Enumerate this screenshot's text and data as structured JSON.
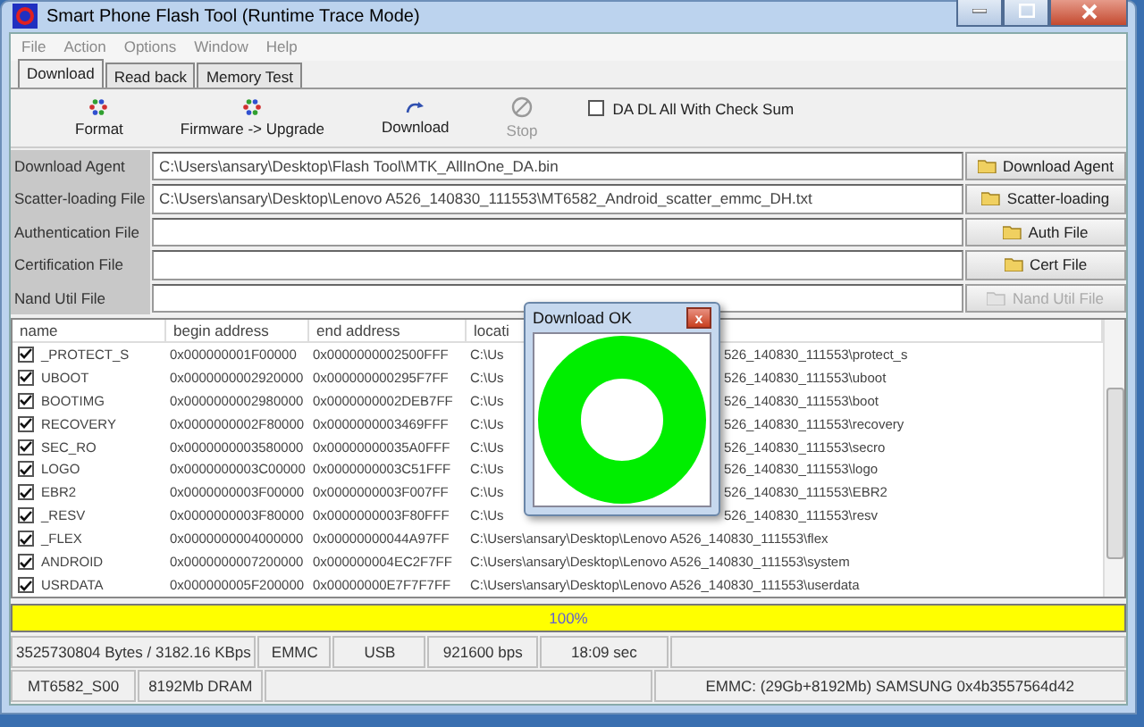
{
  "window": {
    "title": "Smart Phone Flash Tool (Runtime Trace Mode)"
  },
  "menu": [
    {
      "label": "File",
      "disabled": true
    },
    {
      "label": "Action",
      "disabled": true
    },
    {
      "label": "Options",
      "disabled": true
    },
    {
      "label": "Window",
      "disabled": true
    },
    {
      "label": "Help",
      "disabled": true
    }
  ],
  "tabs": [
    {
      "label": "Download",
      "selected": true
    },
    {
      "label": "Read back",
      "selected": false
    },
    {
      "label": "Memory Test",
      "selected": false
    }
  ],
  "toolbar": [
    {
      "kind": "format",
      "label": "Format",
      "disabled": false
    },
    {
      "kind": "firmware",
      "label": "Firmware -> Upgrade",
      "disabled": false
    },
    {
      "kind": "download",
      "label": "Download",
      "disabled": false
    },
    {
      "kind": "stop",
      "label": "Stop",
      "disabled": true
    }
  ],
  "checksum": {
    "label": "DA DL All With Check Sum",
    "checked": false
  },
  "file_rows": [
    {
      "label": "Download Agent",
      "value": "C:\\Users\\ansary\\Desktop\\Flash Tool\\MTK_AllInOne_DA.bin",
      "button": "Download Agent",
      "disabled": false
    },
    {
      "label": "Scatter-loading File",
      "value": "C:\\Users\\ansary\\Desktop\\Lenovo A526_140830_111553\\MT6582_Android_scatter_emmc_DH.txt",
      "button": "Scatter-loading",
      "disabled": false
    },
    {
      "label": "Authentication File",
      "value": "",
      "button": "Auth File",
      "disabled": false
    },
    {
      "label": "Certification File",
      "value": "",
      "button": "Cert File",
      "disabled": false
    },
    {
      "label": "Nand Util File",
      "value": "",
      "button": "Nand Util File",
      "disabled": true
    }
  ],
  "table": {
    "columns": [
      "name",
      "begin address",
      "end address",
      "locati"
    ],
    "rows": [
      {
        "checked": true,
        "name": "_PROTECT_S",
        "begin": "0x000000001F00000",
        "end": "0x0000000002500FFF",
        "location": "C:\\Us",
        "location_tail": "526_140830_111553\\protect_s"
      },
      {
        "checked": true,
        "name": "UBOOT",
        "begin": "0x0000000002920000",
        "end": "0x000000000295F7FF",
        "location": "C:\\Us",
        "location_tail": "526_140830_111553\\uboot"
      },
      {
        "checked": true,
        "name": "BOOTIMG",
        "begin": "0x0000000002980000",
        "end": "0x0000000002DEB7FF",
        "location": "C:\\Us",
        "location_tail": "526_140830_111553\\boot"
      },
      {
        "checked": true,
        "name": "RECOVERY",
        "begin": "0x0000000002F80000",
        "end": "0x0000000003469FFF",
        "location": "C:\\Us",
        "location_tail": "526_140830_111553\\recovery"
      },
      {
        "checked": true,
        "name": "SEC_RO",
        "begin": "0x0000000003580000",
        "end": "0x00000000035A0FFF",
        "location": "C:\\Us",
        "location_tail": "526_140830_111553\\secro"
      },
      {
        "checked": true,
        "name": "LOGO",
        "begin": "0x0000000003C00000",
        "end": "0x0000000003C51FFF",
        "location": "C:\\Us",
        "location_tail": "526_140830_111553\\logo"
      },
      {
        "checked": true,
        "name": "EBR2",
        "begin": "0x0000000003F00000",
        "end": "0x0000000003F007FF",
        "location": "C:\\Us",
        "location_tail": "526_140830_111553\\EBR2"
      },
      {
        "checked": true,
        "name": "_RESV",
        "begin": "0x0000000003F80000",
        "end": "0x0000000003F80FFF",
        "location": "C:\\Us",
        "location_tail": "526_140830_111553\\resv"
      },
      {
        "checked": true,
        "name": "_FLEX",
        "begin": "0x0000000004000000",
        "end": "0x00000000044A97FF",
        "location": "C:\\Users\\ansary\\Desktop\\Lenovo A526_140830_111553\\flex"
      },
      {
        "checked": true,
        "name": "ANDROID",
        "begin": "0x0000000007200000",
        "end": "0x000000004EC2F7FF",
        "location": "C:\\Users\\ansary\\Desktop\\Lenovo A526_140830_111553\\system"
      },
      {
        "checked": true,
        "name": "USRDATA",
        "begin": "0x000000005F200000",
        "end": "0x00000000E7F7F7FF",
        "location": "C:\\Users\\ansary\\Desktop\\Lenovo A526_140830_111553\\userdata"
      }
    ]
  },
  "dialog": {
    "title": "Download OK",
    "close": "x"
  },
  "progress": {
    "level": 1,
    "label": "100%"
  },
  "status_rows": [
    [
      "3525730804 Bytes / 3182.16 KBps",
      "EMMC",
      "USB",
      "921600 bps",
      "18:09 sec",
      ""
    ],
    [
      "MT6582_S00",
      "8192Mb DRAM",
      "",
      "EMMC: (29Gb+8192Mb) SAMSUNG 0x4b3557564d42"
    ]
  ]
}
